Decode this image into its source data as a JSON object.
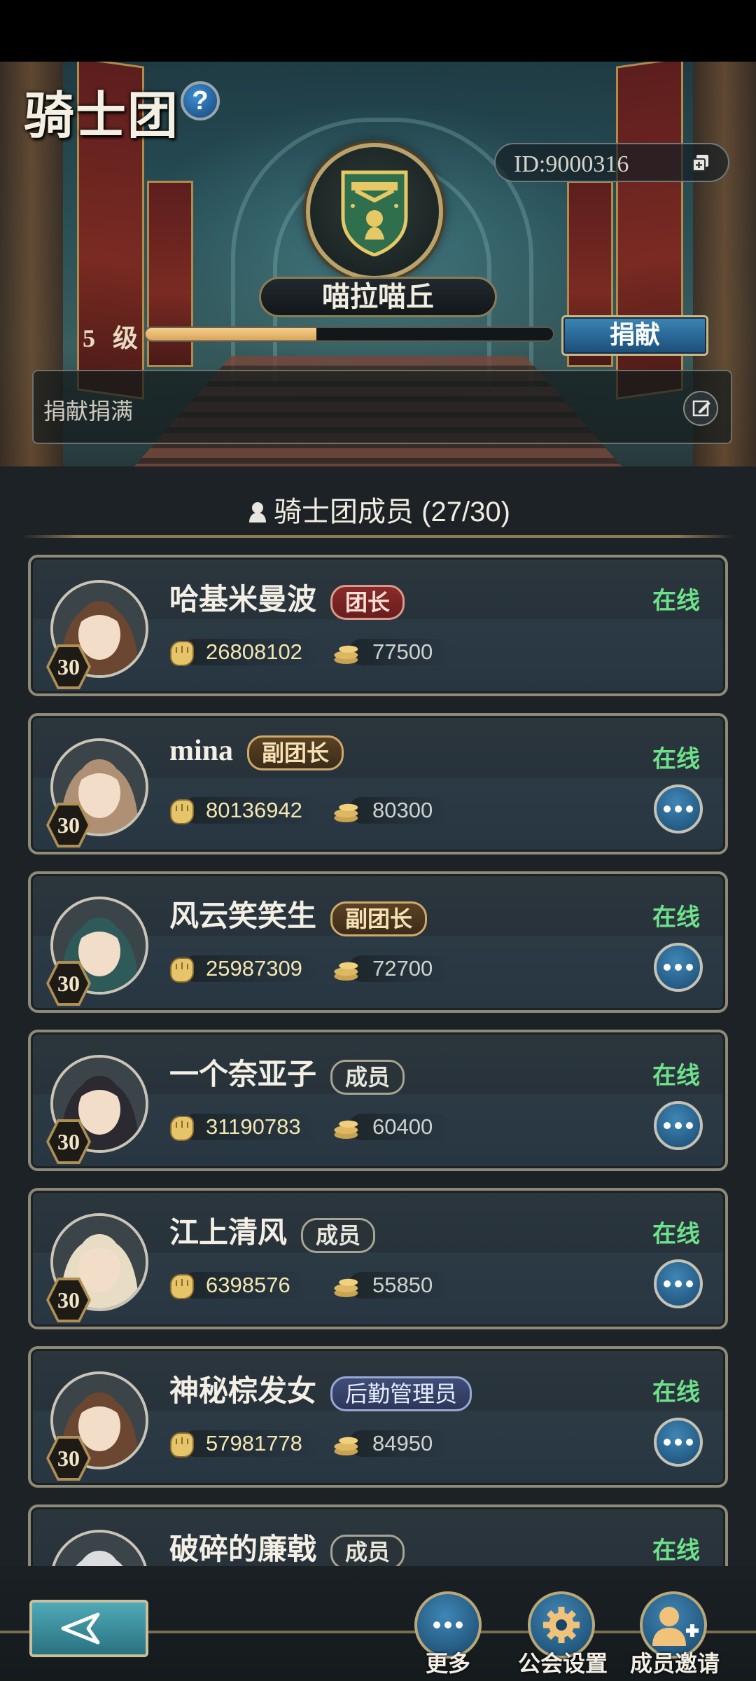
{
  "header": {
    "title": "骑士团",
    "help_symbol": "?",
    "id_label": "ID:9000316",
    "guild_name": "喵拉喵丘",
    "level_label": "5 级",
    "level_progress_fraction": 0.42,
    "donate_label": "捐献",
    "notice_text": "捐献捐满"
  },
  "members_section": {
    "title": "骑士团成员 (27/30)"
  },
  "members": [
    {
      "name": "哈基米曼波",
      "role": "团长",
      "status": "在线",
      "level": "30",
      "power": "26808102",
      "coins": "77500"
    },
    {
      "name": "mina",
      "role": "副团长",
      "status": "在线",
      "level": "30",
      "power": "80136942",
      "coins": "80300"
    },
    {
      "name": "风云笑笑生",
      "role": "副团长",
      "status": "在线",
      "level": "30",
      "power": "25987309",
      "coins": "72700"
    },
    {
      "name": "一个奈亚子",
      "role": "成员",
      "status": "在线",
      "level": "30",
      "power": "31190783",
      "coins": "60400"
    },
    {
      "name": "江上清风",
      "role": "成员",
      "status": "在线",
      "level": "30",
      "power": "6398576",
      "coins": "55850"
    },
    {
      "name": "神秘棕发女",
      "role": "后勤管理员",
      "status": "在线",
      "level": "30",
      "power": "57981778",
      "coins": "84950"
    },
    {
      "name": "破碎的廉戟",
      "role": "成员",
      "status": "在线"
    }
  ],
  "bottom_nav": {
    "more_label": "更多",
    "settings_label": "公会设置",
    "invite_label": "成员邀请"
  },
  "colors": {
    "online": "#6ee08a",
    "leader_badge": "#8a2a2a",
    "vice_badge": "#5a4224",
    "logistics_badge": "#3f4d78",
    "accent_gold": "#b9a26b"
  }
}
